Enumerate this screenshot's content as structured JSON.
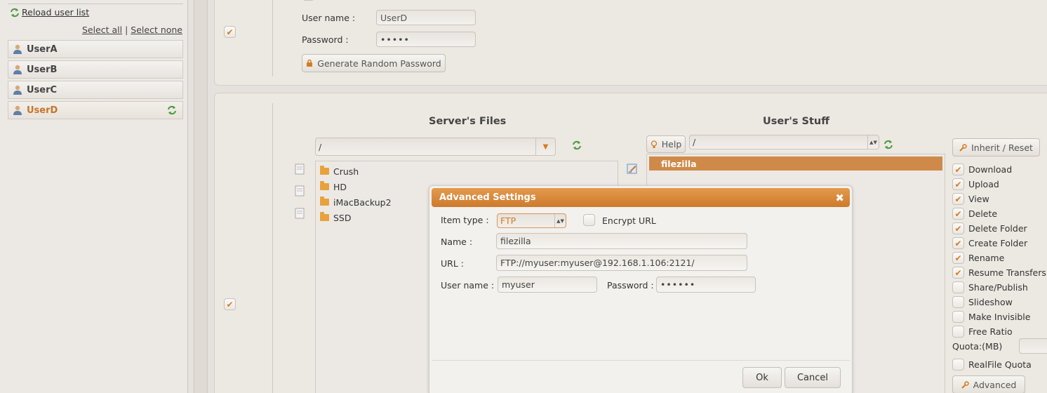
{
  "sidebar": {
    "reload_label": "Reload user list",
    "select_all": "Select all",
    "separator": "|",
    "select_none": "Select none",
    "users": [
      {
        "name": "UserA",
        "active": false
      },
      {
        "name": "UserB",
        "active": false
      },
      {
        "name": "UserC",
        "active": false
      },
      {
        "name": "UserD",
        "active": true
      }
    ]
  },
  "credentials": {
    "username_label": "User name :",
    "username_value": "UserD",
    "password_label": "Password :",
    "password_value": "•••••",
    "generate_button": "Generate Random Password"
  },
  "files": {
    "server_title": "Server's Files",
    "user_title": "User's Stuff",
    "server_path": "/",
    "user_path": "/",
    "help_button": "Help",
    "server_items": [
      "Crush",
      "HD",
      "iMacBackup2",
      "SSD"
    ],
    "user_items": [
      "filezilla"
    ]
  },
  "permissions": {
    "inherit_button": "Inherit / Reset",
    "items": [
      {
        "label": "Download",
        "checked": true
      },
      {
        "label": "Upload",
        "checked": true
      },
      {
        "label": "View",
        "checked": true
      },
      {
        "label": "Delete",
        "checked": true
      },
      {
        "label": "Delete Folder",
        "checked": true
      },
      {
        "label": "Create Folder",
        "checked": true
      },
      {
        "label": "Rename",
        "checked": true
      },
      {
        "label": "Resume Transfers",
        "checked": true
      },
      {
        "label": "Share/Publish",
        "checked": false
      },
      {
        "label": "Slideshow",
        "checked": false
      },
      {
        "label": "Make Invisible",
        "checked": false
      },
      {
        "label": "Free Ratio",
        "checked": false
      }
    ],
    "quota_label": "Quota:(MB)",
    "realfile_label": "RealFile Quota",
    "advanced_button": "Advanced"
  },
  "dialog": {
    "title": "Advanced Settings",
    "close_glyph": "✖",
    "item_type_label": "Item type :",
    "item_type_value": "FTP",
    "encrypt_label": "Encrypt URL",
    "name_label": "Name :",
    "name_value": "filezilla",
    "url_label": "URL :",
    "url_value": "FTP://myuser:myuser@192.168.1.106:2121/",
    "username_label": "User name :",
    "username_value": "myuser",
    "password_label": "Password :",
    "password_value": "••••••",
    "ok_button": "Ok",
    "cancel_button": "Cancel"
  },
  "colors": {
    "accent": "#d67a22",
    "selected_row": "#cf8a4a"
  }
}
